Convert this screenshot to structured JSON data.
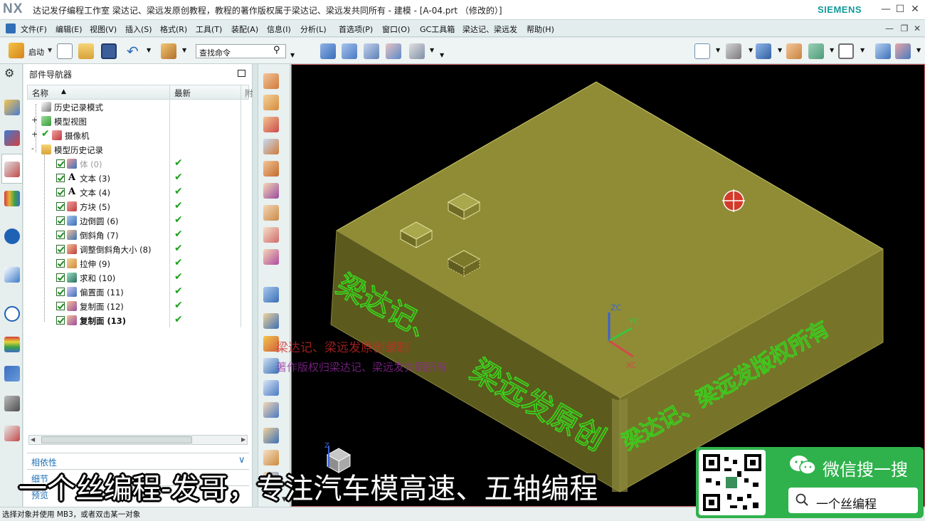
{
  "window": {
    "logo": "NX",
    "title": "达记发仔编程工作室  梁达记、梁远发原创教程，教程的著作版权属于梁达记、梁远发共同所有 - 建模 - [A-04.prt （修改的）]",
    "brand": "SIEMENS"
  },
  "menubar": {
    "items": [
      "文件(F)",
      "编辑(E)",
      "视图(V)",
      "插入(S)",
      "格式(R)",
      "工具(T)",
      "装配(A)",
      "信息(I)",
      "分析(L)",
      "首选项(P)",
      "窗口(O)",
      "GC工具箱",
      "梁达记、梁远发",
      "帮助(H)"
    ]
  },
  "toolbar": {
    "start_label": "启动",
    "search_placeholder": "查找命令"
  },
  "navigator": {
    "title": "部件导航器",
    "col_name": "名称",
    "col_latest": "最新",
    "col_extra": "附",
    "rows": [
      {
        "label": "历史记录模式",
        "indent": 0,
        "expander": "",
        "checked": false,
        "latest": false,
        "dim": false,
        "bold": false,
        "icon": "clock-icon"
      },
      {
        "label": "模型视图",
        "indent": 0,
        "expander": "+",
        "checked": false,
        "latest": false,
        "dim": false,
        "bold": false,
        "icon": "views-icon"
      },
      {
        "label": "摄像机",
        "indent": 0,
        "expander": "+",
        "checked": false,
        "latest": false,
        "dim": false,
        "bold": false,
        "icon": "camera-icon"
      },
      {
        "label": "模型历史记录",
        "indent": 0,
        "expander": "-",
        "checked": false,
        "latest": false,
        "dim": false,
        "bold": false,
        "icon": "folder-icon"
      },
      {
        "label": "体 (0)",
        "indent": 1,
        "expander": "",
        "checked": true,
        "latest": true,
        "dim": true,
        "bold": false,
        "icon": "body-icon"
      },
      {
        "label": "文本 (3)",
        "indent": 1,
        "expander": "",
        "checked": true,
        "latest": true,
        "dim": false,
        "bold": false,
        "icon": "text-icon"
      },
      {
        "label": "文本 (4)",
        "indent": 1,
        "expander": "",
        "checked": true,
        "latest": true,
        "dim": false,
        "bold": false,
        "icon": "text-icon"
      },
      {
        "label": "方块 (5)",
        "indent": 1,
        "expander": "",
        "checked": true,
        "latest": true,
        "dim": false,
        "bold": false,
        "icon": "block-icon"
      },
      {
        "label": "边倒圆 (6)",
        "indent": 1,
        "expander": "",
        "checked": true,
        "latest": true,
        "dim": false,
        "bold": false,
        "icon": "edge-blend-icon"
      },
      {
        "label": "倒斜角 (7)",
        "indent": 1,
        "expander": "",
        "checked": true,
        "latest": true,
        "dim": false,
        "bold": false,
        "icon": "chamfer-icon"
      },
      {
        "label": "调整倒斜角大小 (8)",
        "indent": 1,
        "expander": "",
        "checked": true,
        "latest": true,
        "dim": false,
        "bold": false,
        "icon": "resize-chamfer-icon"
      },
      {
        "label": "拉伸 (9)",
        "indent": 1,
        "expander": "",
        "checked": true,
        "latest": true,
        "dim": false,
        "bold": false,
        "icon": "extrude-icon"
      },
      {
        "label": "求和 (10)",
        "indent": 1,
        "expander": "",
        "checked": true,
        "latest": true,
        "dim": false,
        "bold": false,
        "icon": "unite-icon"
      },
      {
        "label": "偏置面 (11)",
        "indent": 1,
        "expander": "",
        "checked": true,
        "latest": true,
        "dim": false,
        "bold": false,
        "icon": "offset-face-icon"
      },
      {
        "label": "复制面 (12)",
        "indent": 1,
        "expander": "",
        "checked": true,
        "latest": true,
        "dim": false,
        "bold": false,
        "icon": "copy-face-icon"
      },
      {
        "label": "复制面 (13)",
        "indent": 1,
        "expander": "",
        "checked": true,
        "latest": true,
        "dim": false,
        "bold": true,
        "icon": "copy-face-icon"
      }
    ],
    "panel_dependencies": "相依性",
    "panel_details": "细节",
    "panel_preview": "预览"
  },
  "graphics": {
    "wm_3d_top": "梁达记、",
    "wm_3d_mid": "梁远发原创",
    "wm_3d_right": "梁达记、梁远发版权所有",
    "wm_red": "梁达记、梁远发原创录制",
    "wm_purple": "著作版权归梁达记、梁远发共同所有",
    "axis_zc": "ZC",
    "axis_yc": "YC",
    "axis_xc": "XC",
    "triad_z": "Z",
    "colors": {
      "model_top": "#8f8c35",
      "model_left": "#5c5a1d",
      "model_right": "#7a7728",
      "text3d": "#3ad11c",
      "selection": "#d23a2a"
    }
  },
  "status": {
    "text": "选择对象并使用 MB3，或者双击某一对象"
  },
  "overlay": {
    "subtitle": "一个丝编程-发哥，专注汽车模高速、五轴编程",
    "wechat_title": "微信搜一搜",
    "wechat_search": "一个丝编程"
  }
}
